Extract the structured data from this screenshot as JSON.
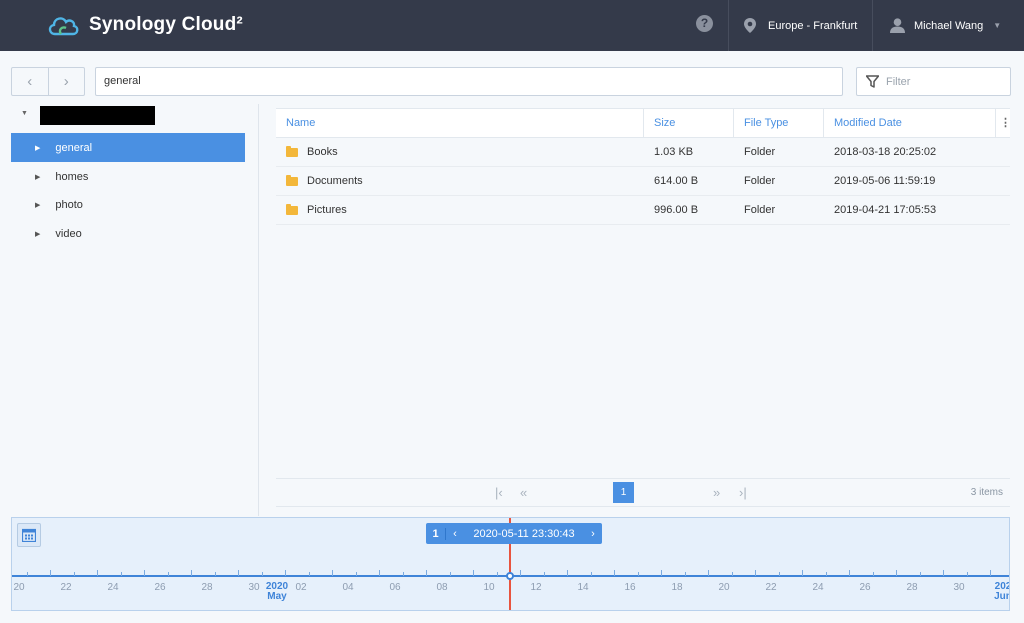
{
  "header": {
    "logo_text": "Synology Cloud²",
    "help_glyph": "?",
    "region": "Europe - Frankfurt",
    "user": "Michael Wang"
  },
  "toolbar": {
    "back_glyph": "‹",
    "forward_glyph": "›",
    "path": "general",
    "filter_placeholder": "Filter"
  },
  "tree": {
    "items": [
      {
        "label": "general"
      },
      {
        "label": "homes"
      },
      {
        "label": "photo"
      },
      {
        "label": "video"
      }
    ]
  },
  "table": {
    "columns": [
      "Name",
      "Size",
      "File Type",
      "Modified Date"
    ],
    "rows": [
      {
        "name": "Books",
        "size": "1.03 KB",
        "type": "Folder",
        "modified": "2018-03-18 20:25:02"
      },
      {
        "name": "Documents",
        "size": "614.00 B",
        "type": "Folder",
        "modified": "2019-05-06 11:59:19"
      },
      {
        "name": "Pictures",
        "size": "996.00 B",
        "type": "Folder",
        "modified": "2019-04-21 17:05:53"
      }
    ]
  },
  "pager": {
    "page": "1",
    "count": "3 items"
  },
  "timeline": {
    "version": "1",
    "datetime": "2020-05-11 23:30:43",
    "prev_glyph": "‹",
    "next_glyph": "›",
    "tick_labels": [
      "20",
      "22",
      "24",
      "26",
      "28",
      "30",
      "02",
      "04",
      "06",
      "08",
      "10",
      "12",
      "14",
      "16",
      "18",
      "20",
      "22",
      "24",
      "26",
      "28",
      "30"
    ],
    "month_may_year": "2020",
    "month_may": "May",
    "month_jun_year": "202",
    "month_jun": "Jun"
  },
  "colors": {
    "accent": "#4a90e2",
    "header_bg": "#343a4a",
    "folder": "#f3b73a",
    "cursor": "#e8543e"
  },
  "icons": [
    "synology-cloud-logo-icon",
    "help-icon",
    "location-pin-icon",
    "user-icon",
    "filter-icon",
    "folder-icon",
    "calendar-icon"
  ]
}
